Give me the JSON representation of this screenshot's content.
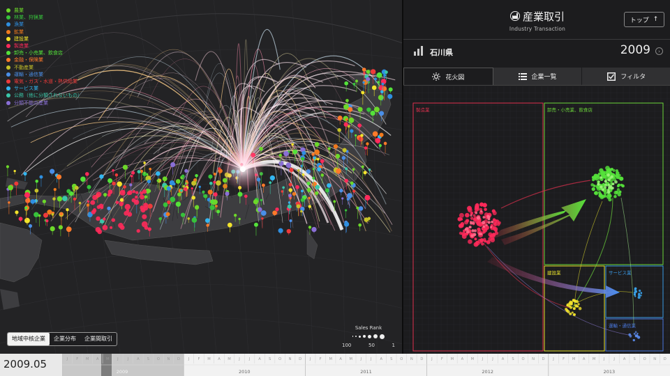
{
  "legend": [
    {
      "label": "農業",
      "color": "#6cd82a"
    },
    {
      "label": "林業、狩猟業",
      "color": "#37c23b"
    },
    {
      "label": "漁業",
      "color": "#2f8fe0"
    },
    {
      "label": "鉱業",
      "color": "#f07a1d"
    },
    {
      "label": "建設業",
      "color": "#f2e32c"
    },
    {
      "label": "製造業",
      "color": "#ff2a5a"
    },
    {
      "label": "卸売・小売業、飲食店",
      "color": "#54e23a"
    },
    {
      "label": "金融・保険業",
      "color": "#ff7a2a"
    },
    {
      "label": "不動産業",
      "color": "#c6c229"
    },
    {
      "label": "運輸・通信業",
      "color": "#4a8fe8"
    },
    {
      "label": "電気・ガス・水道・熱供給業",
      "color": "#ee3a3a"
    },
    {
      "label": "サービス業",
      "color": "#33b6f0"
    },
    {
      "label": "公務（他に分類されないもの）",
      "color": "#3ac7a8"
    },
    {
      "label": "分類不能の産業",
      "color": "#8a6fd6"
    }
  ],
  "map_modes": [
    "地域中核企業",
    "企業分布",
    "企業間取引"
  ],
  "sales_rank": {
    "title": "Sales Rank",
    "labels": [
      "100",
      "50",
      "1"
    ]
  },
  "header": {
    "title": "産業取引",
    "subtitle": "Industry Transaction",
    "top_button": "トップ",
    "top_arrow": "↑"
  },
  "prefecture": {
    "name": "石川県",
    "year": "2009",
    "next": "›"
  },
  "tabs": [
    {
      "label": "花火図",
      "icon": "sun-icon"
    },
    {
      "label": "企業一覧",
      "icon": "list-icon"
    },
    {
      "label": "フィルタ",
      "icon": "checkbox-icon"
    }
  ],
  "viz_boxes": [
    {
      "label": "製造業",
      "color": "#e0304e"
    },
    {
      "label": "卸売・小売業、飲食店",
      "color": "#6cd83a"
    },
    {
      "label": "建設業",
      "color": "#e8e22c"
    },
    {
      "label": "サービス業",
      "color": "#3a9be8"
    },
    {
      "label": "運輸・通信業",
      "color": "#4a78e0"
    }
  ],
  "timeline": {
    "current": "2009.05",
    "months": [
      "J",
      "F",
      "M",
      "A",
      "M",
      "J",
      "J",
      "A",
      "S",
      "O",
      "N",
      "D"
    ],
    "years": [
      "2009",
      "2010",
      "2011",
      "2012",
      "2013"
    ]
  }
}
